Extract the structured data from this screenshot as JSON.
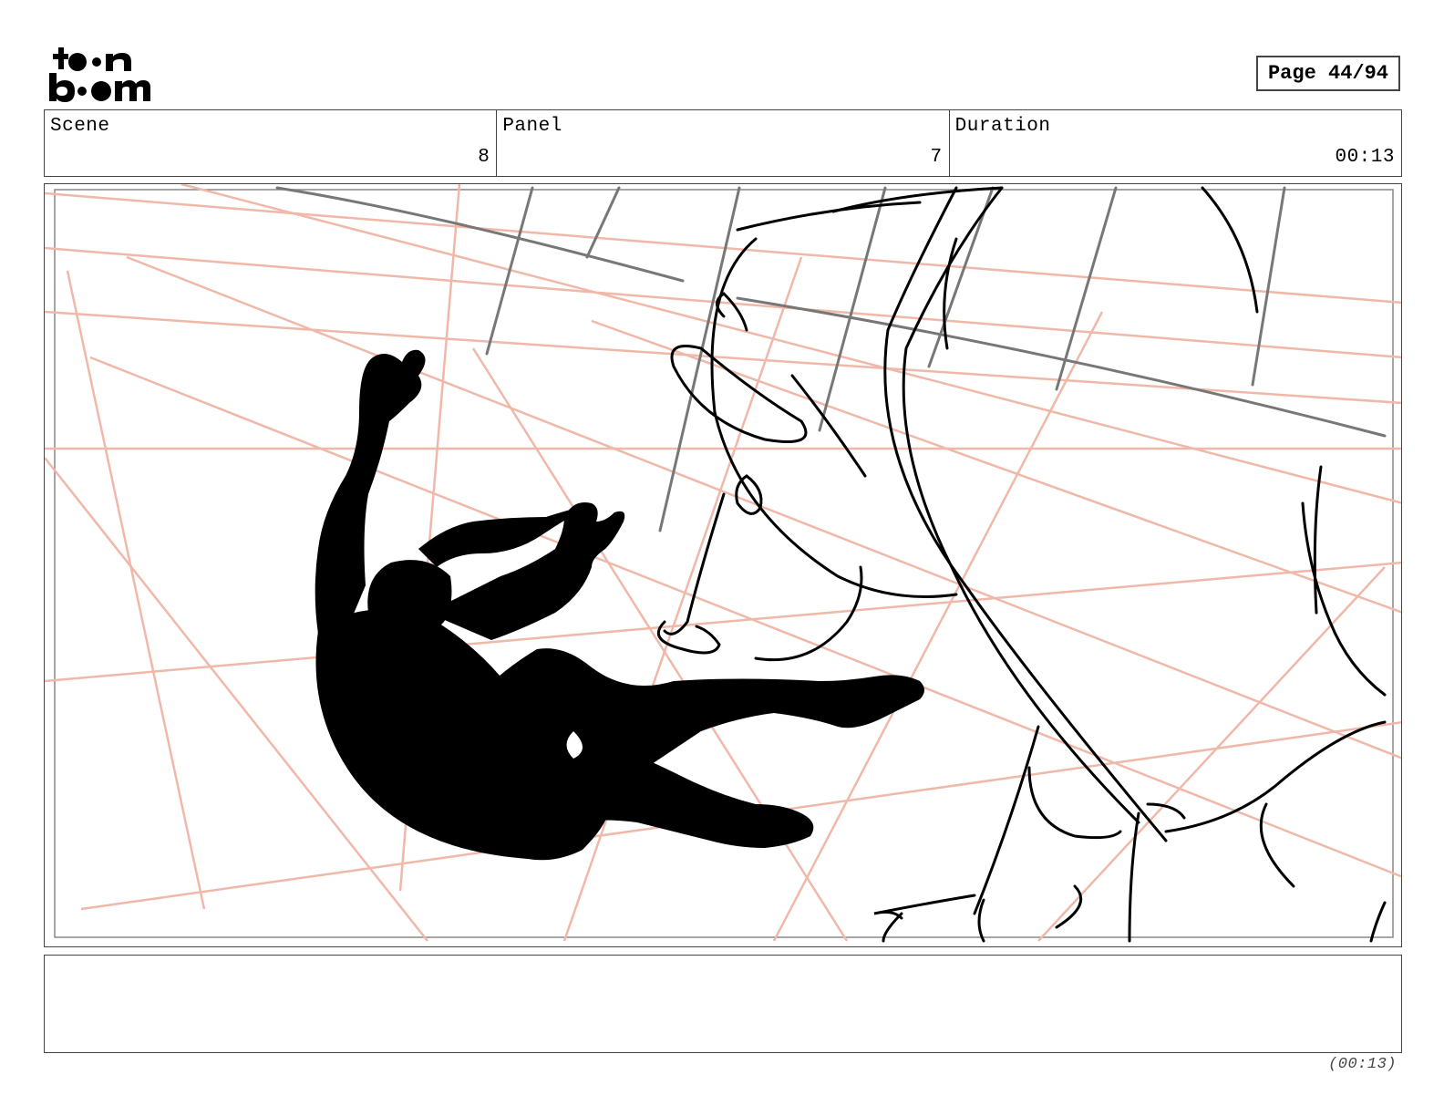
{
  "logo": {
    "line1": "toon",
    "line2": "boom"
  },
  "page": {
    "label": "Page 44/94"
  },
  "scene": {
    "label": "Scene",
    "value": "8"
  },
  "panel": {
    "label": "Panel",
    "value": "7"
  },
  "duration": {
    "label": "Duration",
    "value": "00:13"
  },
  "footer": {
    "duration": "(00:13)"
  },
  "colors": {
    "guide_lines": "#f0b8a8",
    "ink": "#000000",
    "frame": "#444444",
    "sketch_gray": "#777777"
  }
}
